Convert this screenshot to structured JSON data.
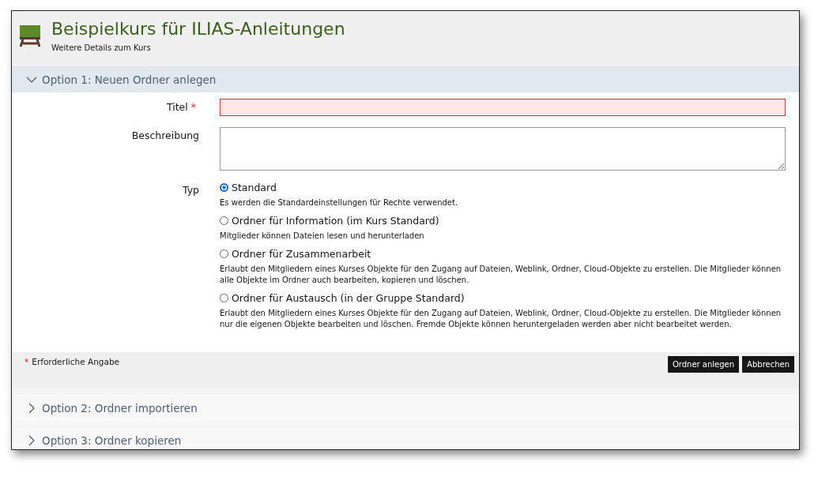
{
  "header": {
    "title": "Beispielkurs für ILIAS-Anleitungen",
    "subtitle": "Weitere Details zum Kurs"
  },
  "panels": [
    {
      "title": "Option 1: Neuen Ordner anlegen",
      "expanded": true
    },
    {
      "title": "Option 2: Ordner importieren",
      "expanded": false
    },
    {
      "title": "Option 3: Ordner kopieren",
      "expanded": false
    }
  ],
  "form": {
    "fields": [
      {
        "kind": "text",
        "label": "Titel",
        "required_mark": "*",
        "error": true
      },
      {
        "kind": "textarea",
        "label": "Beschreibung",
        "error": false
      }
    ],
    "type_label": "Typ",
    "options": [
      {
        "label": "Standard",
        "description": "Es werden die Standardeinstellungen für Rechte verwendet.",
        "selected": true
      },
      {
        "label": "Ordner für Information (im Kurs Standard)",
        "description": "Mitglieder können Dateien lesen und herunterladen",
        "selected": false
      },
      {
        "label": "Ordner für Zusammenarbeit",
        "description": "Erlaubt den Mitgliedern eines Kurses Objekte für den Zugang auf Dateien, Weblink, Ordner, Cloud-Objekte zu erstellen. Die Mitglieder können alle Objekte im Ordner auch bearbeiten, kopieren und löschen.",
        "selected": false
      },
      {
        "label": "Ordner für Austausch (in der Gruppe Standard)",
        "description": "Erlaubt den Mitgliedern eines Kurses Objekte für den Zugang auf Dateien, Weblink, Ordner, Cloud-Objekte zu erstellen. Die Mitglieder können nur die eigenen Objekte bearbeiten und löschen. Fremde Objekte können heruntergeladen werden aber nicht bearbeitet werden.",
        "selected": false
      }
    ],
    "required_mark": "*",
    "required_note": "Erforderliche Angabe",
    "buttons": [
      "Ordner anlegen",
      "Abbrechen"
    ]
  }
}
